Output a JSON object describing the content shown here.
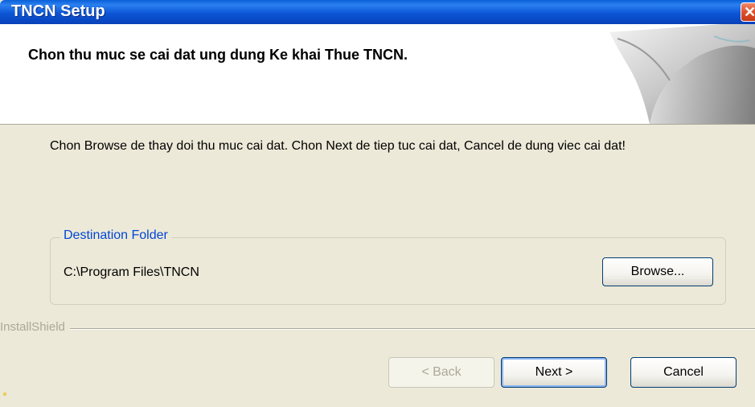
{
  "window": {
    "title": "TNCN Setup",
    "close_icon": "close-icon"
  },
  "header": {
    "title": "Chon thu muc se cai dat ung dung Ke khai Thue TNCN."
  },
  "body": {
    "description": "Chon Browse de thay doi thu muc cai dat. Chon Next de tiep tuc cai dat, Cancel de dung viec cai dat!",
    "destination": {
      "group_label": "Destination Folder",
      "path": "C:\\Program Files\\TNCN",
      "browse_label": "Browse..."
    }
  },
  "footer": {
    "brand": "InstallShield",
    "back_label": "< Back",
    "next_label": "Next >",
    "cancel_label": "Cancel"
  },
  "colors": {
    "title_bar": "#0c56d6",
    "group_label": "#0046d5",
    "dialog_bg": "#ece9d8"
  }
}
